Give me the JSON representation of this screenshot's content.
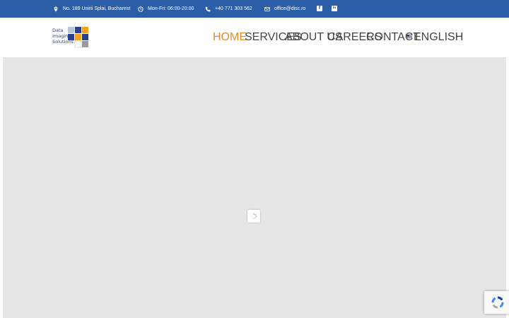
{
  "topbar": {
    "address": "No. 189 Unirii Splai, Bucharest",
    "hours": "Mon-Fri: 06:00-20:00",
    "phone": "+40 771 303 562",
    "email": "office@disc.ro",
    "social": [
      "facebook-icon",
      "linkedin-icon"
    ],
    "social_letters": {
      "facebook": "f",
      "linkedin": "in"
    }
  },
  "logo": {
    "line1": "Data",
    "line2": "Imaging",
    "line3": "Solutions"
  },
  "nav": {
    "home": "HOME",
    "services": "SERVICES",
    "about": "ABOUT US",
    "careers": "CAREERS",
    "contact": "CONTACT",
    "language": "ENGLISH"
  },
  "colors": {
    "topbar_bg": "#2b5ea7",
    "nav_active": "#e28b2b",
    "nav_text": "#444444",
    "content_bg": "#e6e6e6"
  }
}
